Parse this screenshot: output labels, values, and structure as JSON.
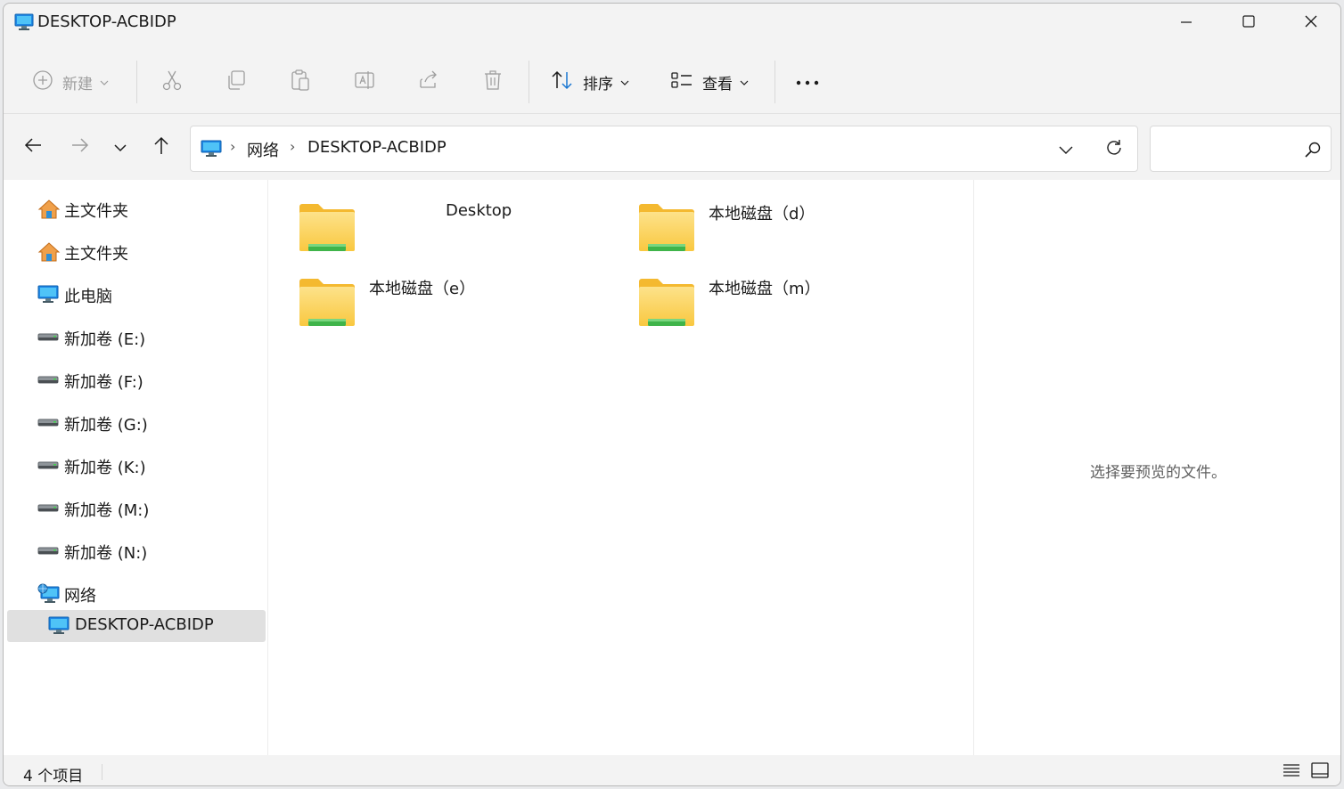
{
  "window": {
    "title": "DESKTOP-ACBIDP",
    "minimize_icon": "minimize-icon",
    "maximize_icon": "maximize-icon",
    "close_icon": "close-icon"
  },
  "toolbar": {
    "new_label": "新建",
    "sort_label": "排序",
    "view_label": "查看",
    "more_icon": "more-icon"
  },
  "address": {
    "crumbs": [
      "网络",
      "DESKTOP-ACBIDP"
    ],
    "search_placeholder": ""
  },
  "sidebar": {
    "items": [
      {
        "label": "主文件夹",
        "icon": "home-icon"
      },
      {
        "label": "主文件夹",
        "icon": "home-icon"
      },
      {
        "label": "此电脑",
        "icon": "computer-icon"
      },
      {
        "label": "新加卷 (E:)",
        "icon": "drive-icon"
      },
      {
        "label": "新加卷 (F:)",
        "icon": "drive-icon"
      },
      {
        "label": "新加卷 (G:)",
        "icon": "drive-icon"
      },
      {
        "label": "新加卷 (K:)",
        "icon": "drive-icon"
      },
      {
        "label": "新加卷 (M:)",
        "icon": "drive-icon"
      },
      {
        "label": "新加卷 (N:)",
        "icon": "drive-icon"
      },
      {
        "label": "网络",
        "icon": "network-icon"
      },
      {
        "label": "DESKTOP-ACBIDP",
        "icon": "computer-icon"
      }
    ]
  },
  "files": [
    {
      "name": "Desktop",
      "icon": "shared-folder-icon"
    },
    {
      "name": "本地磁盘（d）",
      "icon": "shared-folder-icon"
    },
    {
      "name": "本地磁盘（e）",
      "icon": "shared-folder-icon"
    },
    {
      "name": "本地磁盘（m）",
      "icon": "shared-folder-icon"
    }
  ],
  "preview": {
    "empty_text": "选择要预览的文件。"
  },
  "status": {
    "item_count": "4 个项目"
  },
  "colors": {
    "folder_yellow": "#f8cc4a",
    "folder_green": "#3fb44a",
    "selected_bg": "#e0e0e0",
    "accent_blue": "#1976d2"
  }
}
